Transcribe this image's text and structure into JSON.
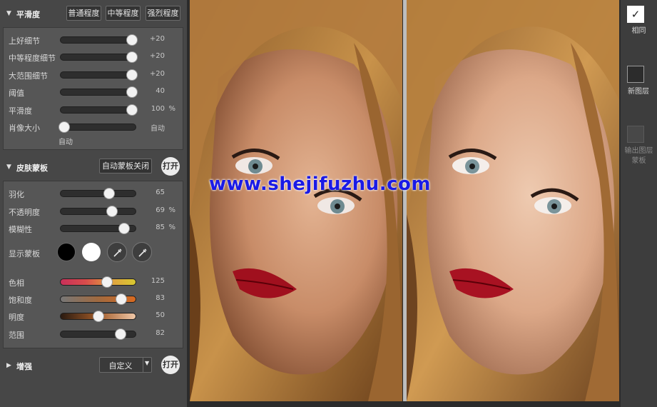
{
  "smoothness": {
    "title": "平滑度",
    "presets": [
      "普通程度",
      "中等程度",
      "强烈程度"
    ],
    "sliders": [
      {
        "label": "上好细节",
        "value": "+20",
        "level": 0.95,
        "unit": ""
      },
      {
        "label": "中等程度细节",
        "value": "+20",
        "level": 0.95,
        "unit": ""
      },
      {
        "label": "大范围细节",
        "value": "+20",
        "level": 0.95,
        "unit": ""
      },
      {
        "label": "阈值",
        "value": "40",
        "level": 0.95,
        "unit": ""
      },
      {
        "label": "平滑度",
        "value": "100",
        "level": 0.95,
        "unit": "%"
      }
    ],
    "portrait_size": {
      "label": "肖像大小",
      "value": "自动",
      "sub_label": "自动",
      "level": 0.05
    }
  },
  "skin_mask": {
    "title": "皮肤蒙板",
    "auto_mask_button": "自动蒙板关闭",
    "open_button": "打开",
    "sliders": [
      {
        "label": "羽化",
        "value": "65",
        "level": 0.65,
        "unit": ""
      },
      {
        "label": "不透明度",
        "value": "69",
        "level": 0.69,
        "unit": "%"
      },
      {
        "label": "模糊性",
        "value": "85",
        "level": 0.85,
        "unit": "%"
      }
    ],
    "show_mask_label": "显示蒙板",
    "color_sliders": [
      {
        "label": "色相",
        "value": "125",
        "level": 0.62,
        "unit": "",
        "style": "hue"
      },
      {
        "label": "饱和度",
        "value": "83",
        "level": 0.81,
        "unit": "",
        "style": "sat"
      },
      {
        "label": "明度",
        "value": "50",
        "level": 0.5,
        "unit": "",
        "style": "lum"
      },
      {
        "label": "范围",
        "value": "82",
        "level": 0.8,
        "unit": "",
        "style": "rng"
      }
    ]
  },
  "enhance": {
    "title": "增强",
    "dropdown_value": "自定义",
    "open_button": "打开"
  },
  "watermark": "www.shejifuzhu.com",
  "right_panel": {
    "same_label": "相同",
    "new_layer_label": "新图层",
    "output_mask_label": "输出图层蒙板"
  },
  "colors": {
    "mask_black": "#000000",
    "mask_white": "#ffffff",
    "watermark": "#1a1ae6"
  }
}
